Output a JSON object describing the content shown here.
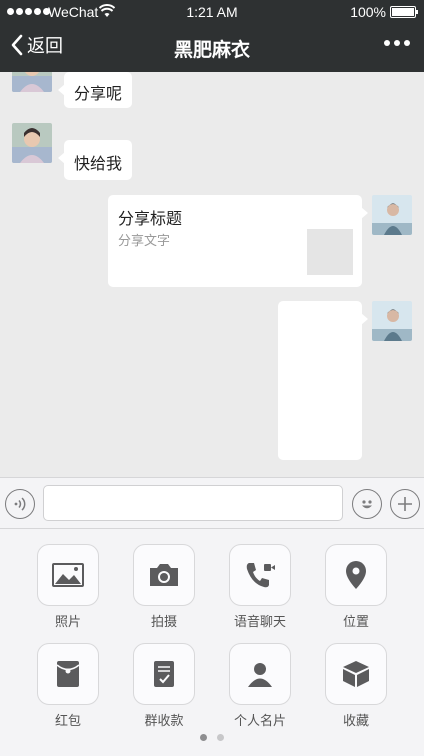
{
  "status_bar": {
    "carrier": "WeChat",
    "time": "1:21 AM",
    "battery": "100%"
  },
  "nav": {
    "back_label": "返回",
    "title": "黑肥麻衣"
  },
  "messages": [
    {
      "side": "left",
      "text": "分享呢"
    },
    {
      "side": "left",
      "text": "快给我"
    },
    {
      "side": "right",
      "type": "share_card",
      "title": "分享标题",
      "description": "分享文字"
    },
    {
      "side": "right",
      "type": "blank"
    }
  ],
  "input": {
    "value": "",
    "placeholder": ""
  },
  "tools": [
    {
      "label": "照片",
      "icon": "image-icon"
    },
    {
      "label": "拍摄",
      "icon": "camera-icon"
    },
    {
      "label": "语音聊天",
      "icon": "video-call-icon"
    },
    {
      "label": "位置",
      "icon": "location-icon"
    },
    {
      "label": "红包",
      "icon": "red-packet-icon"
    },
    {
      "label": "群收款",
      "icon": "group-payment-icon"
    },
    {
      "label": "个人名片",
      "icon": "contact-card-icon"
    },
    {
      "label": "收藏",
      "icon": "favorites-icon"
    }
  ],
  "pager": {
    "pages": 2,
    "current": 1
  },
  "colors": {
    "nav_bg": "#2e3132",
    "chat_bg": "#ebebeb",
    "bubble": "#ffffff",
    "icon": "#5b5b5d"
  }
}
